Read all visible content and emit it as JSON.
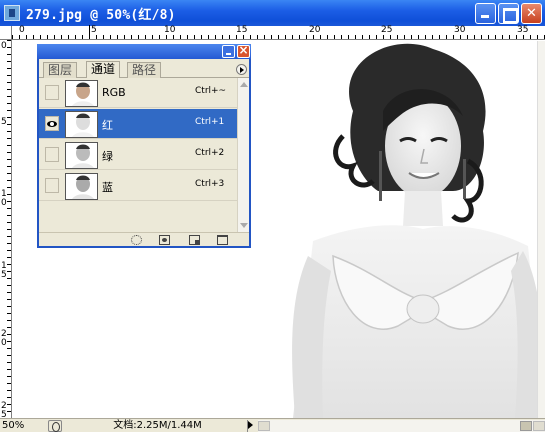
{
  "window": {
    "title": "279.jpg @ 50%(红/8)"
  },
  "rulers": {
    "top_labels": [
      "0",
      "5",
      "10",
      "15",
      "20",
      "25",
      "30",
      "35"
    ],
    "left_labels": [
      "0",
      "5",
      "1\n0",
      "1\n5",
      "2\n0",
      "2\n5"
    ]
  },
  "channels_panel": {
    "tabs": [
      {
        "label": "图层",
        "active": false
      },
      {
        "label": "通道",
        "active": true
      },
      {
        "label": "路径",
        "active": false
      }
    ],
    "channels": [
      {
        "name": "RGB",
        "shortcut": "Ctrl+~",
        "visible": false,
        "selected": false
      },
      {
        "name": "红",
        "shortcut": "Ctrl+1",
        "visible": true,
        "selected": true
      },
      {
        "name": "绿",
        "shortcut": "Ctrl+2",
        "visible": false,
        "selected": false
      },
      {
        "name": "蓝",
        "shortcut": "Ctrl+3",
        "visible": false,
        "selected": false
      }
    ],
    "footer_icons": [
      "load-selection-icon",
      "save-selection-icon",
      "new-channel-icon",
      "trash-icon"
    ]
  },
  "status_bar": {
    "zoom": "50%",
    "doc_info": "文档:2.25M/1.44M"
  },
  "colors": {
    "title_bar": "#1c5ee6",
    "selection": "#316ac5",
    "panel_bg": "#ece9d8"
  }
}
